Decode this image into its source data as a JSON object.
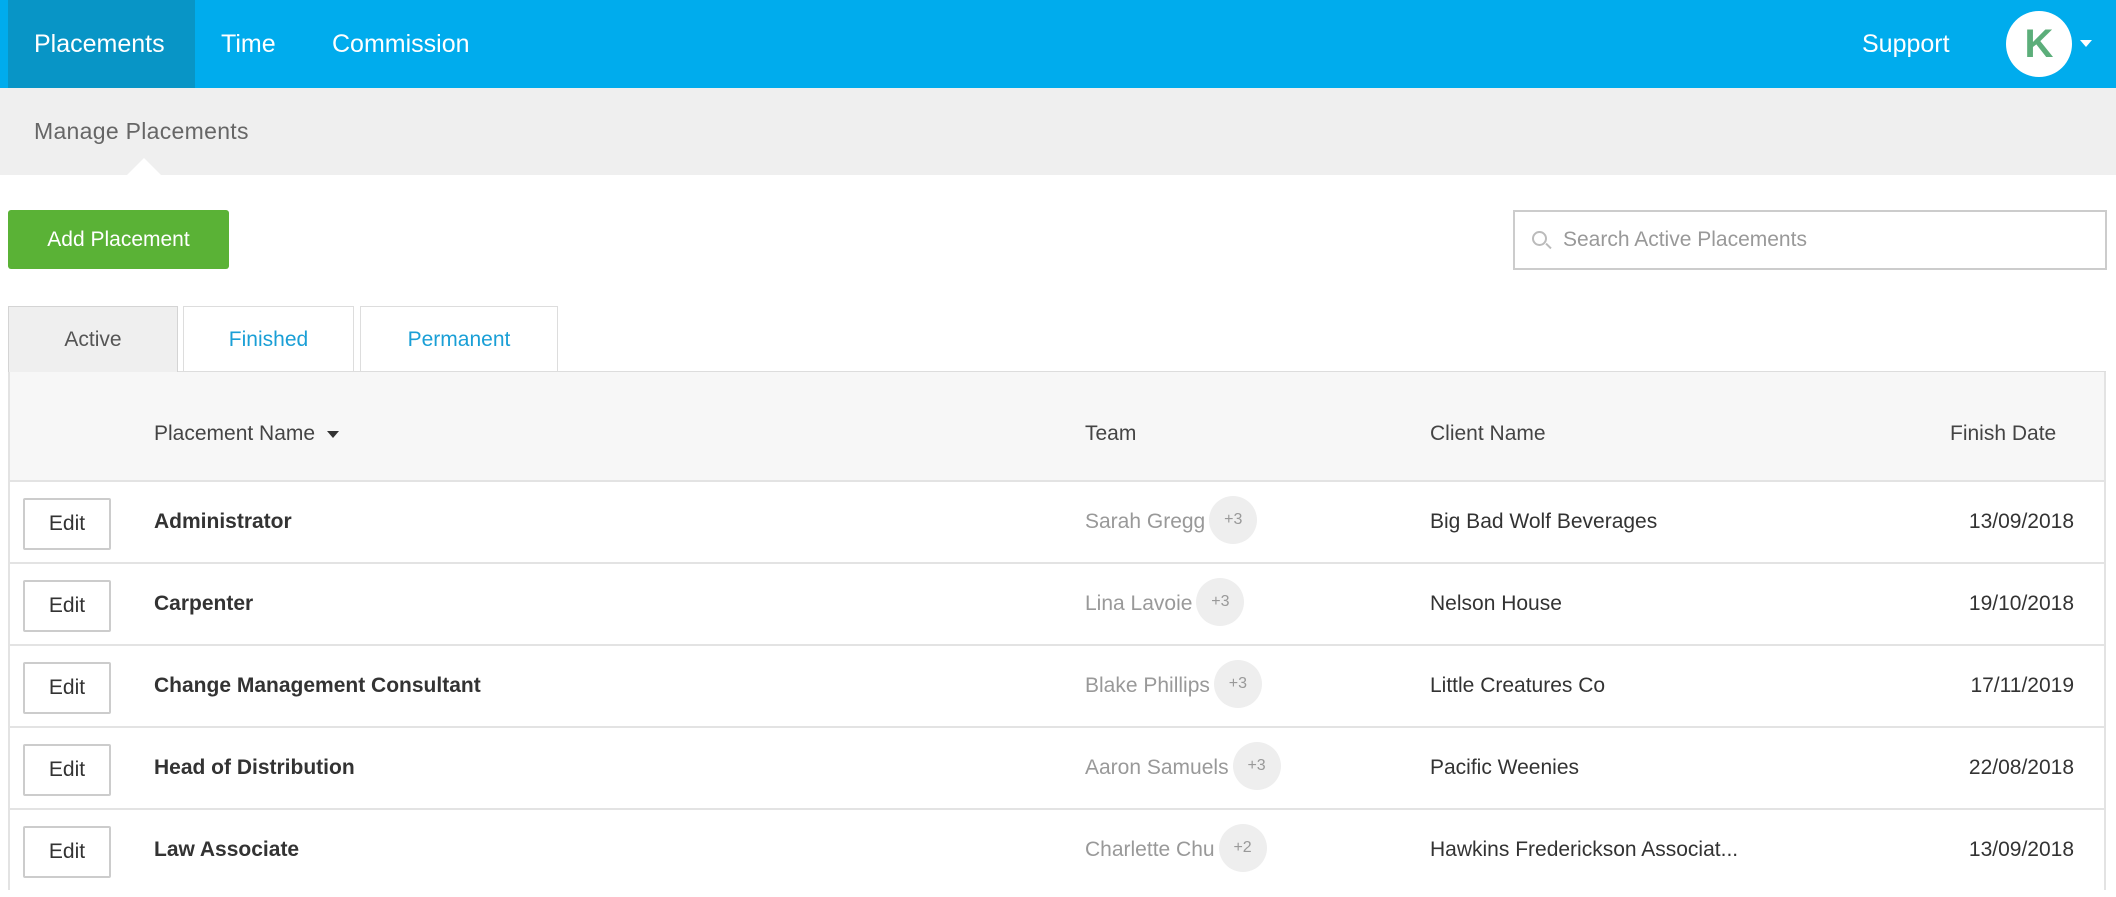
{
  "nav": {
    "items": [
      {
        "label": "Placements"
      },
      {
        "label": "Time"
      },
      {
        "label": "Commission"
      }
    ],
    "support_label": "Support",
    "avatar_initial": "K",
    "brand_color": "#00aced"
  },
  "subheader": {
    "title": "Manage Placements"
  },
  "toolbar": {
    "add_label": "Add Placement",
    "search_placeholder": "Search Active Placements"
  },
  "tabs": [
    {
      "label": "Active"
    },
    {
      "label": "Finished"
    },
    {
      "label": "Permanent"
    }
  ],
  "table": {
    "columns": {
      "name": "Placement Name",
      "team": "Team",
      "client": "Client Name",
      "finish": "Finish Date"
    },
    "edit_label": "Edit",
    "rows": [
      {
        "name": "Administrator",
        "team": "Sarah Gregg",
        "team_more": "+3",
        "client": "Big Bad Wolf Beverages",
        "finish": "13/09/2018"
      },
      {
        "name": "Carpenter",
        "team": "Lina Lavoie",
        "team_more": "+3",
        "client": "Nelson House",
        "finish": "19/10/2018"
      },
      {
        "name": "Change Management Consultant",
        "team": "Blake Phillips",
        "team_more": "+3",
        "client": "Little Creatures Co",
        "finish": "17/11/2019"
      },
      {
        "name": "Head of Distribution",
        "team": "Aaron Samuels",
        "team_more": "+3",
        "client": "Pacific Weenies",
        "finish": "22/08/2018"
      },
      {
        "name": "Law Associate",
        "team": "Charlette Chu",
        "team_more": "+2",
        "client": "Hawkins Frederickson Associat...",
        "finish": "13/09/2018"
      }
    ]
  }
}
